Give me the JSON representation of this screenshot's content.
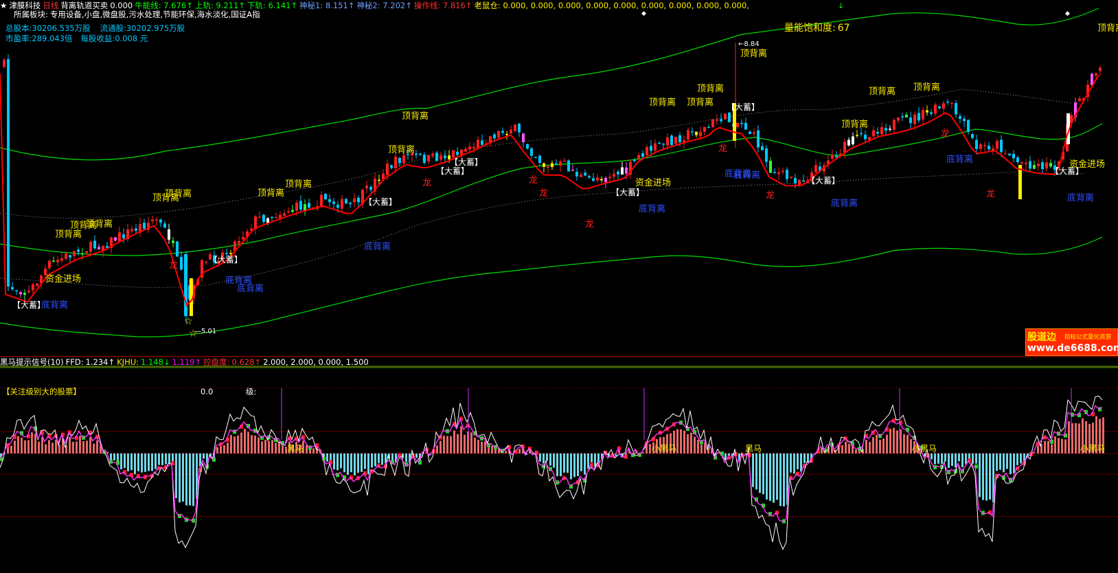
{
  "colors": {
    "bg": "#000000",
    "up": "#ff2020",
    "down": "#00c8ff",
    "yellow": "#ffef00",
    "green_band": "#00dd00",
    "grey_dot": "#9a9a9a",
    "ma": "#ff0000",
    "blue_text": "#3050ff",
    "magenta": "#ff00ff",
    "white": "#ffffff"
  },
  "header": {
    "title": "津膜科技",
    "period": "日线",
    "indicator": "背离轨道买卖",
    "val0": "0.000",
    "items": [
      {
        "label": "牛能线",
        "value": "7.676↑",
        "color": "#00ff00"
      },
      {
        "label": "上轨",
        "value": "9.211↑",
        "color": "#00ff00"
      },
      {
        "label": "下轨",
        "value": "6.141↑",
        "color": "#00ff00"
      },
      {
        "label": "神秘1",
        "value": "8.151↑",
        "color": "#6aa0ff"
      },
      {
        "label": "神秘2",
        "value": "7.202↑",
        "color": "#6aa0ff"
      },
      {
        "label": "操作线",
        "value": "7.816↑",
        "color": "#ff3030"
      },
      {
        "label": "老鼠仓",
        "value": "0.000, 0.000, 0.000, 0.000, 0.000, 0.000, 0.000, 0.000, 0.000,",
        "color": "#ffef00"
      }
    ]
  },
  "sector": {
    "label": "所属板块:",
    "value": "专用设备,小盘,微盘股,污水处理,节能环保,海水淡化,国证A指"
  },
  "fundamentals": {
    "total_shares_label": "总股本:",
    "total_shares": "30206.535万股",
    "float_shares_label": "流通股:",
    "float_shares": "30202.975万股",
    "pe_label": "市盈率:",
    "pe": "289.043倍",
    "eps_label": "每股收益:",
    "eps": "0.008 元"
  },
  "saturation": {
    "label": "量能饱和度:",
    "value": "67"
  },
  "price_marks": {
    "high": "8.84",
    "low": "5.01"
  },
  "signals": {
    "top": "顶背离",
    "bottom": "底背离",
    "dragon": "龙",
    "storage": "【大蓄】",
    "enter": "资金进场"
  },
  "lower_panel": {
    "title": "黑马提示信号",
    "param": "(10)",
    "ffd_label": "FFD:",
    "ffd": "1.234↑",
    "kjhu_label": "KJHU:",
    "kjhu": "1.148↓",
    "kjhu2": "1.119↑",
    "cao_label": "控盘度:",
    "cao": "0.628↑",
    "extra": "2.000, 2.000, 0.000, 1.500",
    "notice": "【关注级别大的股票】",
    "level_value": "0.0",
    "level_label": "级:",
    "black_horse": "黑马",
    "small_black_horse": "小黑马"
  },
  "watermark": {
    "brand": "股道边",
    "sub": "指标公式量化资源",
    "url": "www.de6688.com"
  },
  "chart_data": [
    {
      "type": "candlestick",
      "title": "津膜科技 日线",
      "ohlc_start": 5.8,
      "ylim": [
        4.7,
        9.2
      ],
      "annotations": [
        {
          "text": "8.84",
          "kind": "high"
        },
        {
          "text": "5.01",
          "kind": "low"
        }
      ]
    },
    {
      "type": "line",
      "title": "黑马提示信号",
      "series": [
        {
          "name": "FFD",
          "last": 1.234
        },
        {
          "name": "KJHU",
          "last": 1.148
        }
      ]
    }
  ]
}
